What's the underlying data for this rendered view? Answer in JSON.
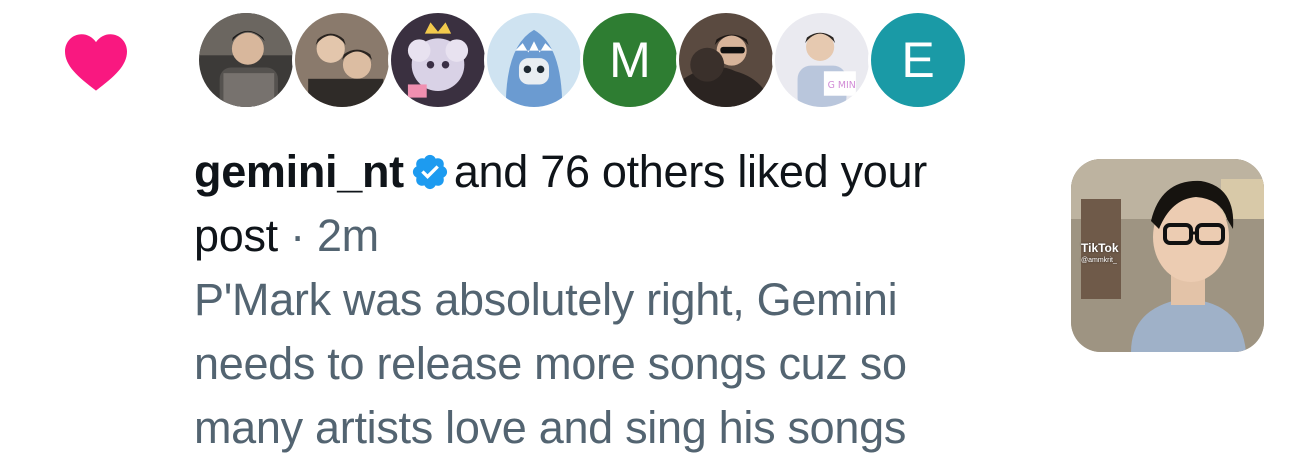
{
  "notification": {
    "type_icon": "heart-icon",
    "heart_color": "#f91880",
    "avatars": [
      {
        "kind": "photo",
        "name": "avatar-photo-1"
      },
      {
        "kind": "photo",
        "name": "avatar-photo-2"
      },
      {
        "kind": "photo",
        "name": "avatar-photo-3"
      },
      {
        "kind": "photo",
        "name": "avatar-photo-4"
      },
      {
        "kind": "letter",
        "letter": "M",
        "color": "#2e7d32"
      },
      {
        "kind": "photo",
        "name": "avatar-photo-6"
      },
      {
        "kind": "photo",
        "name": "avatar-photo-7"
      },
      {
        "kind": "letter",
        "letter": "E",
        "color": "#1a9aa6"
      }
    ],
    "username": "gemini_nt",
    "verified_icon": "verified-badge-icon",
    "verified_color": "#1d9bf0",
    "action_text": "and 76 others liked your",
    "object_text": "post",
    "separator": "·",
    "time": "2m",
    "post_lines": [
      "P'Mark was absolutely right, Gemini",
      "needs to release more songs cuz so",
      "many artists love and sing his songs"
    ],
    "thumbnail": {
      "watermark": "TikTok",
      "handle": "@ammkrit_"
    }
  }
}
